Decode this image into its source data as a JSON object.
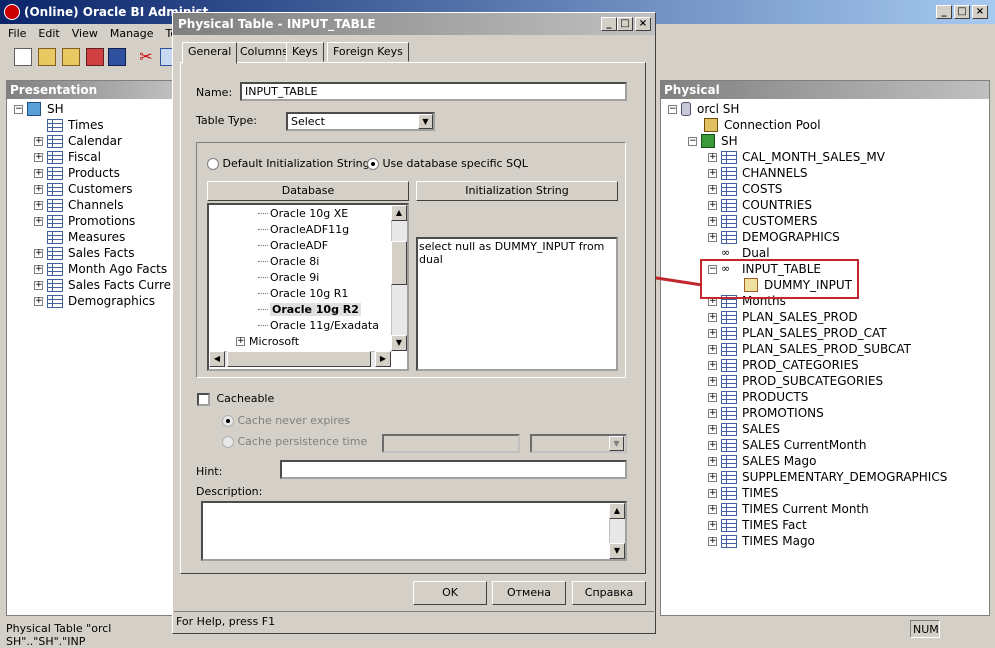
{
  "app": {
    "title": "(Online) Oracle BI Administ",
    "title_obscured_tail": "...",
    "menu": [
      "File",
      "Edit",
      "View",
      "Manage",
      "Tool"
    ]
  },
  "presentation": {
    "title": "Presentation",
    "root": "SH",
    "items": [
      "Times",
      "Calendar",
      "Fiscal",
      "Products",
      "Customers",
      "Channels",
      "Promotions",
      "Measures",
      "Sales Facts",
      "Month Ago Facts",
      "Sales Facts Current M",
      "Demographics"
    ]
  },
  "physical": {
    "title": "Physical",
    "db": "orcl SH",
    "connection_pool": "Connection Pool",
    "schema": "SH",
    "tables": [
      "CAL_MONTH_SALES_MV",
      "CHANNELS",
      "COSTS",
      "COUNTRIES",
      "CUSTOMERS",
      "DEMOGRAPHICS",
      "Dual",
      "INPUT_TABLE",
      "DUMMY_INPUT",
      "Months",
      "PLAN_SALES_PROD",
      "PLAN_SALES_PROD_CAT",
      "PLAN_SALES_PROD_SUBCAT",
      "PROD_CATEGORIES",
      "PROD_SUBCATEGORIES",
      "PRODUCTS",
      "PROMOTIONS",
      "SALES",
      "SALES CurrentMonth",
      "SALES Mago",
      "SUPPLEMENTARY_DEMOGRAPHICS",
      "TIMES",
      "TIMES Current Month",
      "TIMES Fact",
      "TIMES Mago"
    ]
  },
  "dialog": {
    "title": "Physical Table - INPUT_TABLE",
    "tabs": [
      "General",
      "Columns",
      "Keys",
      "Foreign Keys"
    ],
    "name_label": "Name:",
    "name_value": "INPUT_TABLE",
    "type_label": "Table Type:",
    "type_value": "Select",
    "radio_default": "Default Initialization String",
    "radio_db": "Use database specific SQL",
    "col_database": "Database",
    "col_init": "Initialization String",
    "db_items": [
      "Oracle 10g XE",
      "OracleADF11g",
      "OracleADF",
      "Oracle 8i",
      "Oracle 9i",
      "Oracle 10g R1",
      "Oracle 10g R2",
      "Oracle 11g/Exadata",
      "Microsoft"
    ],
    "init_sql": "select null as DUMMY_INPUT from dual",
    "cacheable": "Cacheable",
    "cache_never": "Cache never expires",
    "cache_persist": "Cache persistence time",
    "hint_label": "Hint:",
    "desc_label": "Description:",
    "ok": "OK",
    "cancel": "Отмена",
    "help": "Справка",
    "status": "For Help, press F1"
  },
  "statusbar": {
    "left": "Physical Table \"orcl SH\"..\"SH\".\"INP",
    "num": "NUM"
  },
  "colors": {
    "highlight_box": "#c0282e",
    "arrow": "#c0282e"
  }
}
